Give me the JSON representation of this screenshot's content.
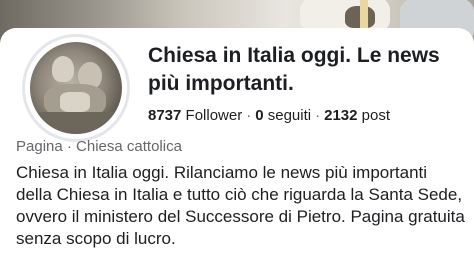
{
  "page": {
    "title": "Chiesa in Italia oggi. Le news più importanti.",
    "stats": {
      "followers_count": "8737",
      "followers_label": "Follower",
      "following_count": "0",
      "following_label": "seguiti",
      "posts_count": "2132",
      "posts_label": "post",
      "separator": "·"
    },
    "category": "Pagina · Chiesa cattolica",
    "description": "Chiesa in Italia oggi. Rilanciamo le news più importanti della Chiesa in Italia e tutto ciò che riguarda la Santa Sede, ovvero il ministero del Successore di Pietro. Pagina gratuita senza scopo di lucro."
  }
}
